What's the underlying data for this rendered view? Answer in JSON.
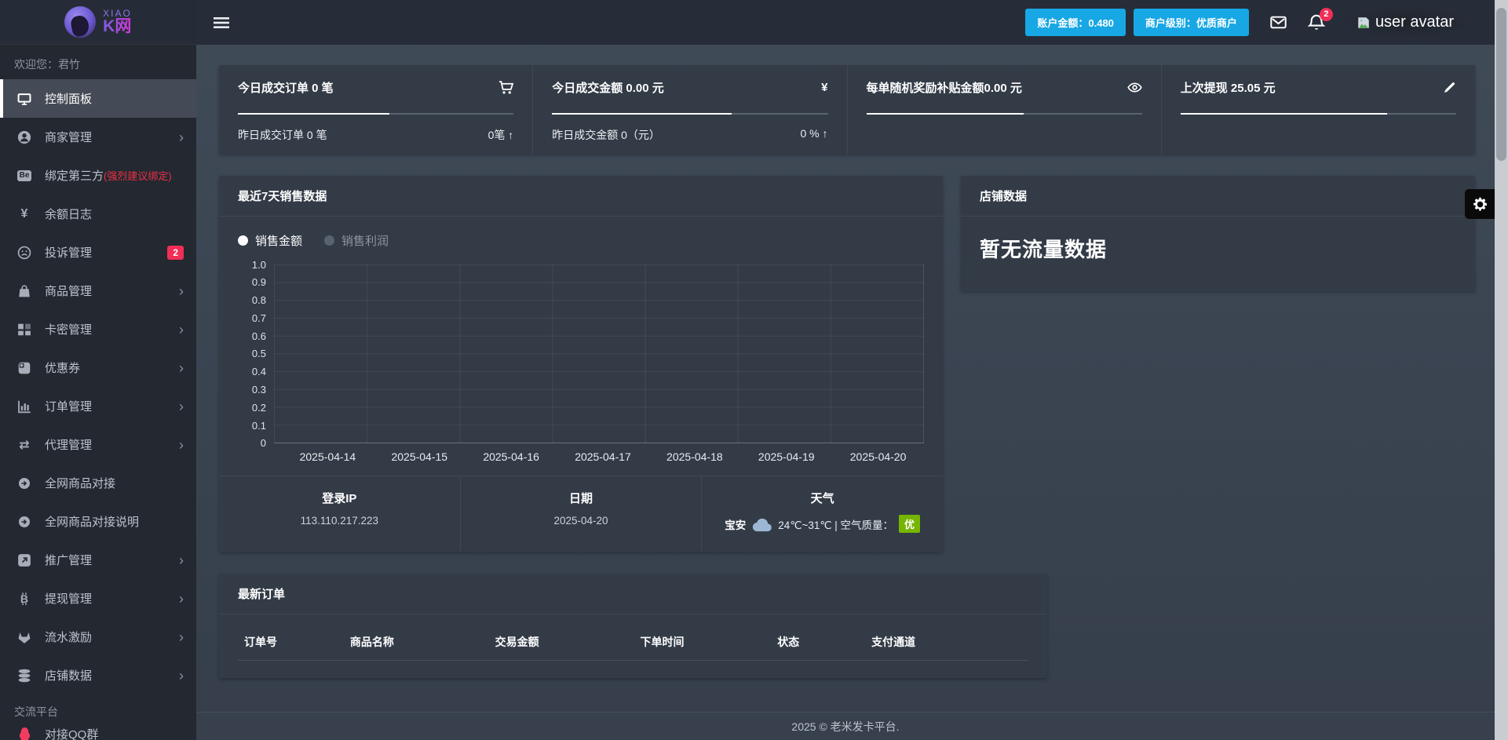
{
  "meta": {
    "footer": "2025 © 老米发卡平台."
  },
  "colors": {
    "accent_blue": "#17a7e4",
    "accent_red": "#f22e56",
    "accent_green": "#76b500",
    "sidebar_bg": "#232831",
    "panel_bg": "#333b47",
    "topbar_bg": "#272d38"
  },
  "sidebar": {
    "logo": {
      "top": "XIAO",
      "main": "K网"
    },
    "welcome": "欢迎您：君竹",
    "items": [
      {
        "label": "控制面板",
        "icon": "monitor-icon",
        "active": true
      },
      {
        "label": "商家管理",
        "icon": "user-icon",
        "chevron": true
      },
      {
        "label": "绑定第三方",
        "suffix": "(强烈建议绑定)",
        "icon": "be-icon"
      },
      {
        "label": "余额日志",
        "icon": "yen-icon"
      },
      {
        "label": "投诉管理",
        "icon": "frown-icon",
        "badge": "2"
      },
      {
        "label": "商品管理",
        "icon": "bag-icon",
        "chevron": true
      },
      {
        "label": "卡密管理",
        "icon": "blocks-icon",
        "chevron": true
      },
      {
        "label": "优惠券",
        "icon": "coupon-icon",
        "chevron": true
      },
      {
        "label": "订单管理",
        "icon": "chart-bar-icon",
        "chevron": true
      },
      {
        "label": "代理管理",
        "icon": "swap-icon",
        "chevron": true
      },
      {
        "label": "全网商品对接",
        "icon": "arrow-circle-icon"
      },
      {
        "label": "全网商品对接说明",
        "icon": "arrow-circle-icon"
      },
      {
        "label": "推广管理",
        "icon": "external-icon",
        "chevron": true
      },
      {
        "label": "提现管理",
        "icon": "bitcoin-icon",
        "chevron": true
      },
      {
        "label": "流水激励",
        "icon": "gitlab-icon",
        "chevron": true
      },
      {
        "label": "店铺数据",
        "icon": "database-icon",
        "chevron": true
      }
    ],
    "section_label": "交流平台",
    "qq_item": {
      "label": "对接QQ群",
      "icon": "qq-icon"
    }
  },
  "topbar": {
    "badges": [
      {
        "label": "账户金额：0.480"
      },
      {
        "label": "商户级别：优质商户"
      }
    ],
    "notification_count": "2",
    "avatar_alt": "user avatar"
  },
  "stats": [
    {
      "title": "今日成交订单 0 笔",
      "icon": "cart-icon",
      "progress_pct": 55,
      "sub_left": "昨日成交订单 0 笔",
      "sub_right": "0笔 ↑"
    },
    {
      "title": "今日成交金额 0.00 元",
      "icon": "yen-icon",
      "progress_pct": 65,
      "sub_left": "昨日成交金额 0（元）",
      "sub_right": "0 % ↑"
    },
    {
      "title": "每单随机奖励补贴金额0.00 元",
      "icon": "eye-icon",
      "progress_pct": 57,
      "sub_left": "",
      "sub_right": ""
    },
    {
      "title": "上次提现 25.05 元",
      "icon": "pencil-icon",
      "progress_pct": 75,
      "sub_left": "",
      "sub_right": ""
    }
  ],
  "chart_panel": {
    "title": "最近7天销售数据",
    "legend": [
      {
        "label": "销售金额",
        "active": true
      },
      {
        "label": "销售利润",
        "active": false
      }
    ]
  },
  "chart_data": {
    "type": "line",
    "title": "最近7天销售数据",
    "categories": [
      "2025-04-14",
      "2025-04-15",
      "2025-04-16",
      "2025-04-17",
      "2025-04-18",
      "2025-04-19",
      "2025-04-20"
    ],
    "series": [
      {
        "name": "销售金额",
        "values": []
      },
      {
        "name": "销售利润",
        "values": []
      }
    ],
    "ylim": [
      0,
      1.0
    ],
    "yticks": [
      "1.0",
      "0.9",
      "0.8",
      "0.7",
      "0.6",
      "0.5",
      "0.4",
      "0.3",
      "0.2",
      "0.1",
      "0"
    ],
    "grid": true,
    "legend_position": "top-left"
  },
  "info_row": [
    {
      "label": "登录IP",
      "value": "113.110.217.223"
    },
    {
      "label": "日期",
      "value": "2025-04-20"
    },
    {
      "label": "天气",
      "city": "宝安",
      "temp_air": "24℃~31℃ | 空气质量：",
      "aqi": "优"
    }
  ],
  "shop_panel": {
    "title": "店铺数据",
    "empty_text": "暂无流量数据"
  },
  "orders_panel": {
    "title": "最新订单",
    "columns": [
      "订单号",
      "商品名称",
      "交易金额",
      "下单时间",
      "状态",
      "支付通道"
    ],
    "rows": []
  }
}
